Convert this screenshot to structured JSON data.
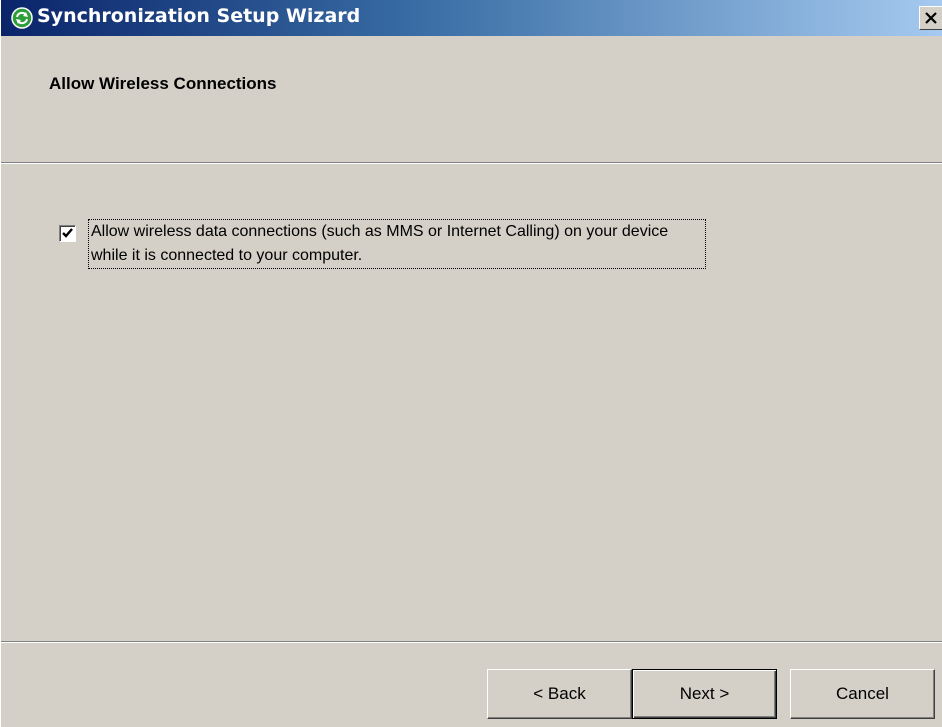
{
  "window": {
    "title": "Synchronization Setup Wizard",
    "icon": "sync-icon",
    "close_icon": "close-icon"
  },
  "header": {
    "title": "Allow Wireless Connections"
  },
  "option": {
    "checked": true,
    "label": "Allow wireless data connections (such as MMS or Internet Calling) on your device while it is connected to your computer."
  },
  "buttons": {
    "back": "< Back",
    "next": "Next >",
    "cancel": "Cancel"
  },
  "colors": {
    "titlebar_start": "#0a246a",
    "titlebar_end": "#a6caf0",
    "face": "#d4d0c8",
    "icon_green": "#2e9e3c"
  }
}
